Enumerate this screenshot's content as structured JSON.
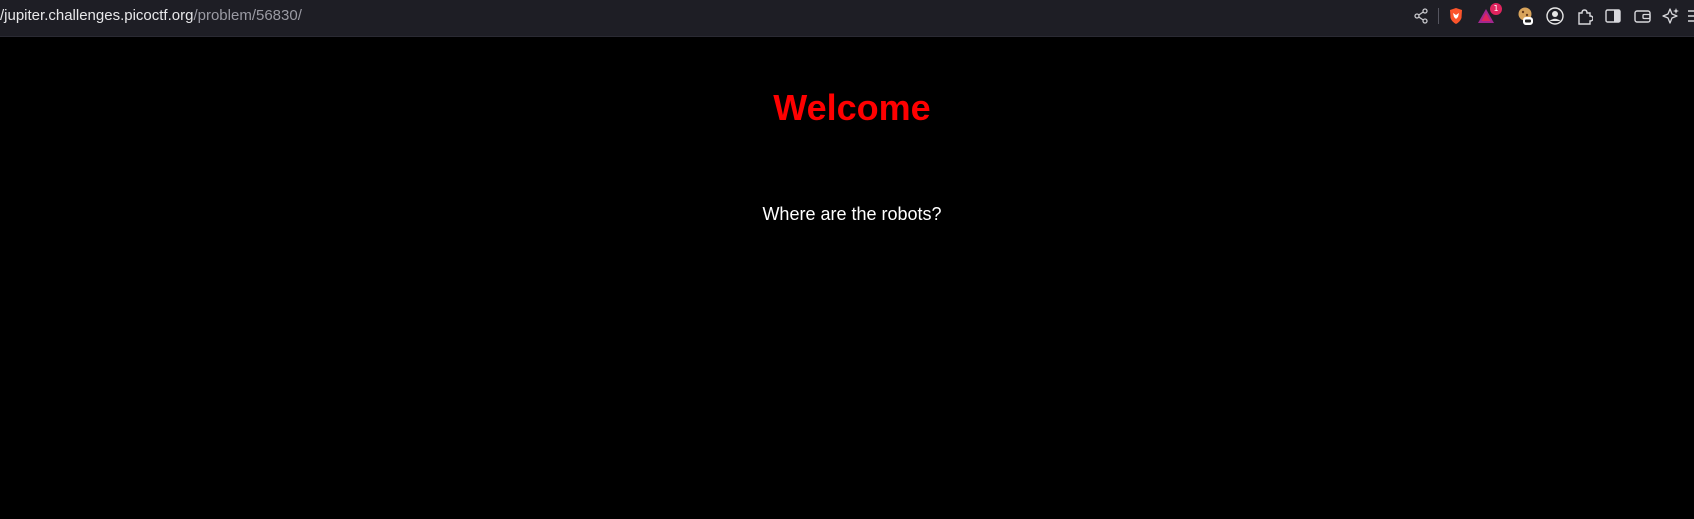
{
  "address_bar": {
    "host": "/jupiter.challenges.picoctf.org",
    "path": "/problem/56830/"
  },
  "toolbar": {
    "icons": [
      "share-icon",
      "brave-shields-icon",
      "brave-rewards-icon",
      "cookie-extension-icon",
      "profile-extension-icon",
      "extensions-puzzle-icon",
      "sidebar-toggle-icon",
      "wallet-icon",
      "leo-ai-icon",
      "menu-icon"
    ],
    "rewards_badge": "1"
  },
  "page": {
    "heading": "Welcome",
    "text": "Where are the robots?"
  },
  "colors": {
    "toolbar_bg": "#1e1e25",
    "page_bg": "#000000",
    "heading": "#ff0000",
    "text": "#ffffff"
  }
}
